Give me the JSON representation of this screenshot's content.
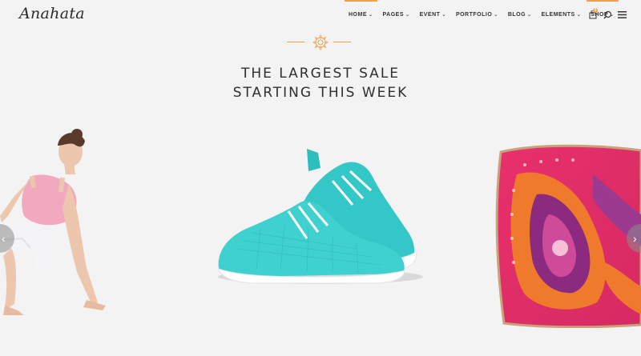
{
  "header": {
    "logo": "Anahata",
    "nav": [
      {
        "label": "HOME",
        "active": true
      },
      {
        "label": "PAGES",
        "active": false
      },
      {
        "label": "EVENT",
        "active": false
      },
      {
        "label": "PORTFOLIO",
        "active": false
      },
      {
        "label": "BLOG",
        "active": false
      },
      {
        "label": "ELEMENTS",
        "active": false
      },
      {
        "label": "SHOP",
        "active": true
      }
    ],
    "icons": [
      "cart-icon",
      "search-icon",
      "menu-icon"
    ],
    "cart_count": "0"
  },
  "hero": {
    "headline_line1": "THE LARGEST SALE",
    "headline_line2": "STARTING THIS WEEK",
    "accent": "#f0a04b",
    "slides": [
      "yoga-woman",
      "turquoise-sneakers",
      "paisley-pillow"
    ]
  }
}
